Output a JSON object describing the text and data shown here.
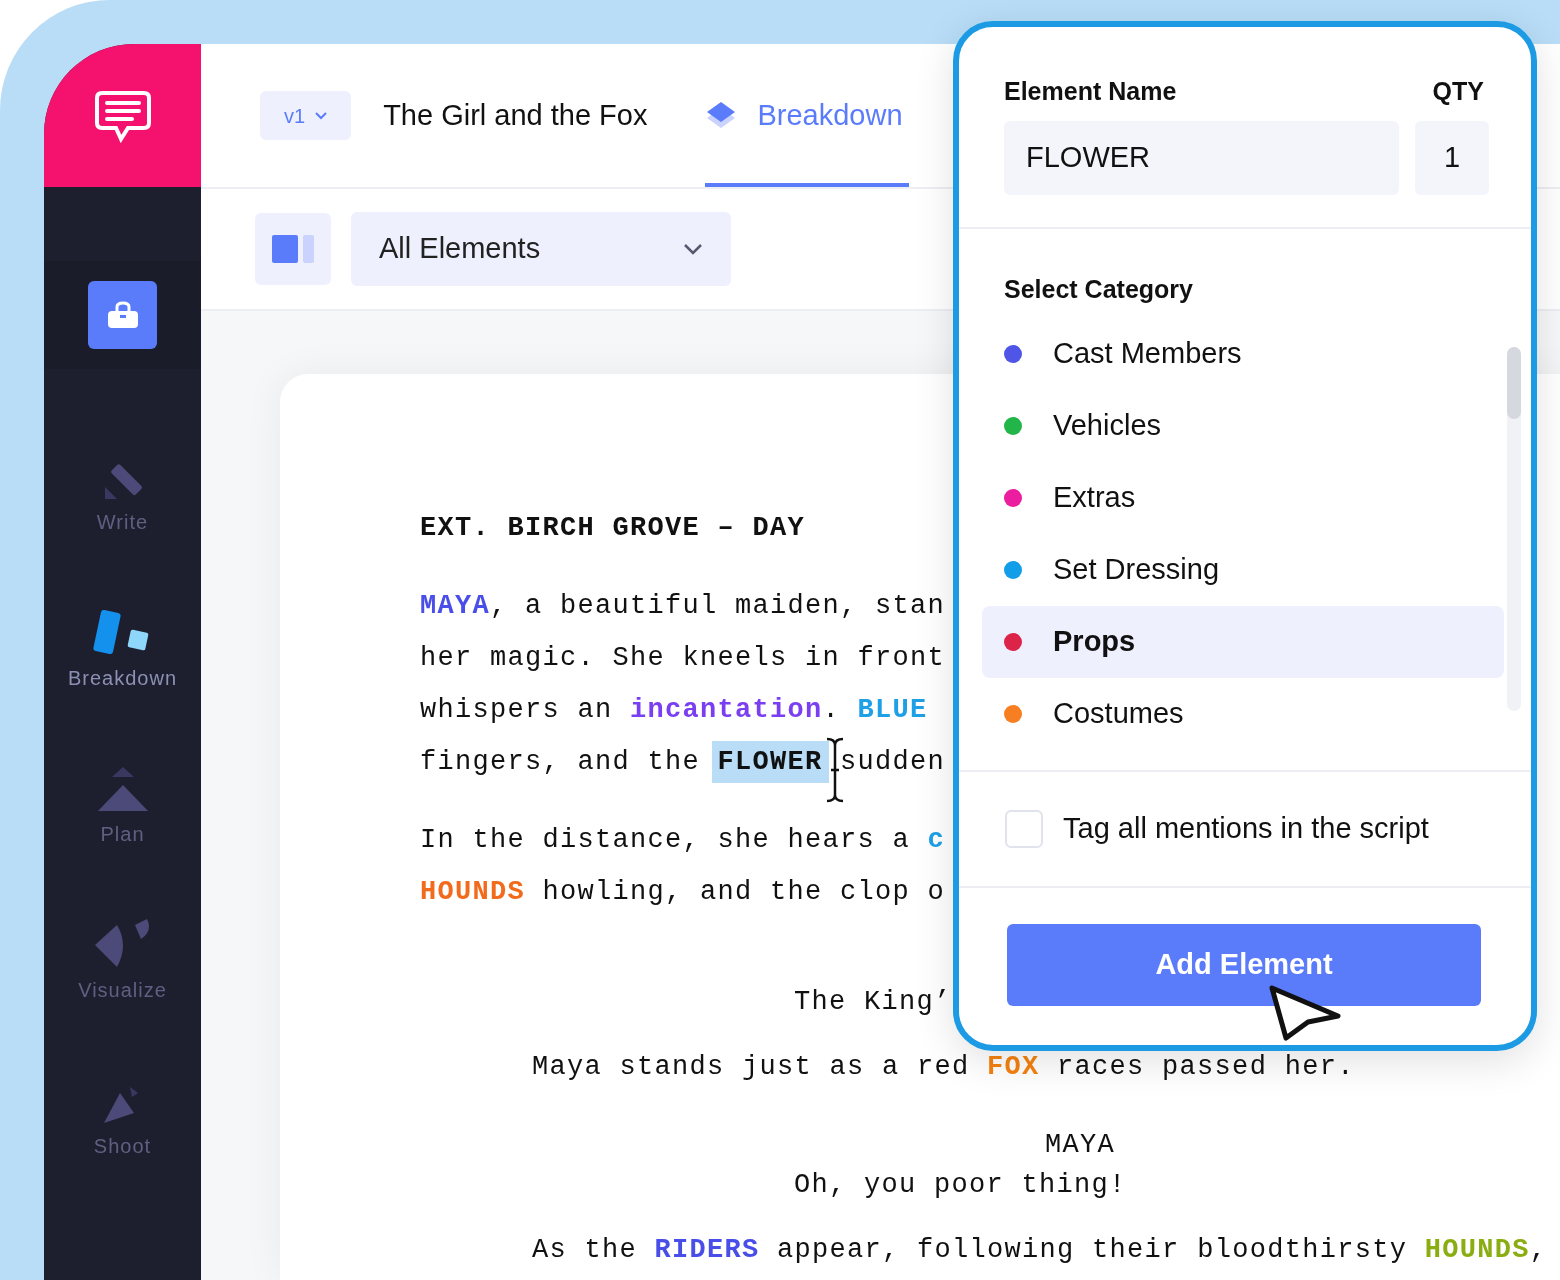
{
  "sidebar": {
    "tool_button": {
      "selected": true
    },
    "items": [
      {
        "label": "Write",
        "kind": "write",
        "selected": false
      },
      {
        "label": "Breakdown",
        "kind": "breakdown",
        "selected": true
      },
      {
        "label": "Plan",
        "kind": "plan",
        "selected": false
      },
      {
        "label": "Visualize",
        "kind": "visualize",
        "selected": false
      },
      {
        "label": "Shoot",
        "kind": "shoot",
        "selected": false
      }
    ]
  },
  "topbar": {
    "version": "v1",
    "title": "The Girl and the Fox",
    "tabs": [
      {
        "label": "Breakdown",
        "selected": true
      }
    ]
  },
  "toolbar": {
    "filter": "All Elements"
  },
  "script": [
    {
      "kind": "heading",
      "lines": [
        [
          {
            "text": "EXT. BIRCH GROVE – DAY"
          }
        ]
      ]
    },
    {
      "kind": "action",
      "lines": [
        [
          {
            "text": "MAYA",
            "color": "#4a4ee8"
          },
          {
            "text": ", a beautiful maiden, stan"
          }
        ],
        [
          {
            "text": "her magic. She kneels in front"
          }
        ],
        [
          {
            "text": "whispers an "
          },
          {
            "text": "incantation",
            "color": "#7b3ff2"
          },
          {
            "text": ". "
          },
          {
            "text": "BLUE",
            "color": "#1ea0e6"
          }
        ],
        [
          {
            "text": "fingers, and the "
          },
          {
            "text": "FLOWER",
            "color": "#111111",
            "highlighted": true
          },
          {
            "text": " sudden"
          }
        ]
      ]
    },
    {
      "kind": "action",
      "lines": [
        [
          {
            "text": "In the distance, she hears a "
          },
          {
            "text": "c",
            "color": "#1ea0e6"
          }
        ],
        [
          {
            "text": "HOUNDS",
            "color": "#f26a1b"
          },
          {
            "text": " howling, and the clop o"
          }
        ]
      ]
    },
    {
      "kind": "centered",
      "lines": [
        [
          {
            "text": "The King’"
          }
        ]
      ]
    },
    {
      "kind": "indented",
      "lines": [
        [
          {
            "text": "Maya stands just as a red "
          },
          {
            "text": "FOX",
            "color": "#f5820f"
          },
          {
            "text": " races passed her."
          }
        ]
      ]
    },
    {
      "kind": "character",
      "lines": [
        [
          {
            "text": "MAYA"
          }
        ]
      ]
    },
    {
      "kind": "dialogue",
      "lines": [
        [
          {
            "text": "Oh, you poor thing!"
          }
        ]
      ]
    },
    {
      "kind": "indented",
      "lines": [
        [
          {
            "text": "As the "
          },
          {
            "text": "RIDERS",
            "color": "#4a4ee8"
          },
          {
            "text": " appear, following their bloodthirsty "
          },
          {
            "text": "HOUNDS",
            "color": "#8aad12"
          },
          {
            "text": ","
          }
        ]
      ]
    }
  ],
  "popup": {
    "name_label": "Element Name",
    "qty_label": "QTY",
    "name_value": "FLOWER",
    "qty_value": "1",
    "category_label": "Select Category",
    "categories": [
      {
        "label": "Cast Members",
        "color": "#4f55e6",
        "selected": false
      },
      {
        "label": "Vehicles",
        "color": "#22b54a",
        "selected": false
      },
      {
        "label": "Extras",
        "color": "#ec1ea0",
        "selected": false
      },
      {
        "label": "Set Dressing",
        "color": "#119de8",
        "selected": false
      },
      {
        "label": "Props",
        "color": "#dc2348",
        "selected": true
      },
      {
        "label": "Costumes",
        "color": "#f77f22",
        "selected": false
      }
    ],
    "tag_all": {
      "label": "Tag all mentions in the script",
      "checked": false
    },
    "button": "Add Element"
  }
}
